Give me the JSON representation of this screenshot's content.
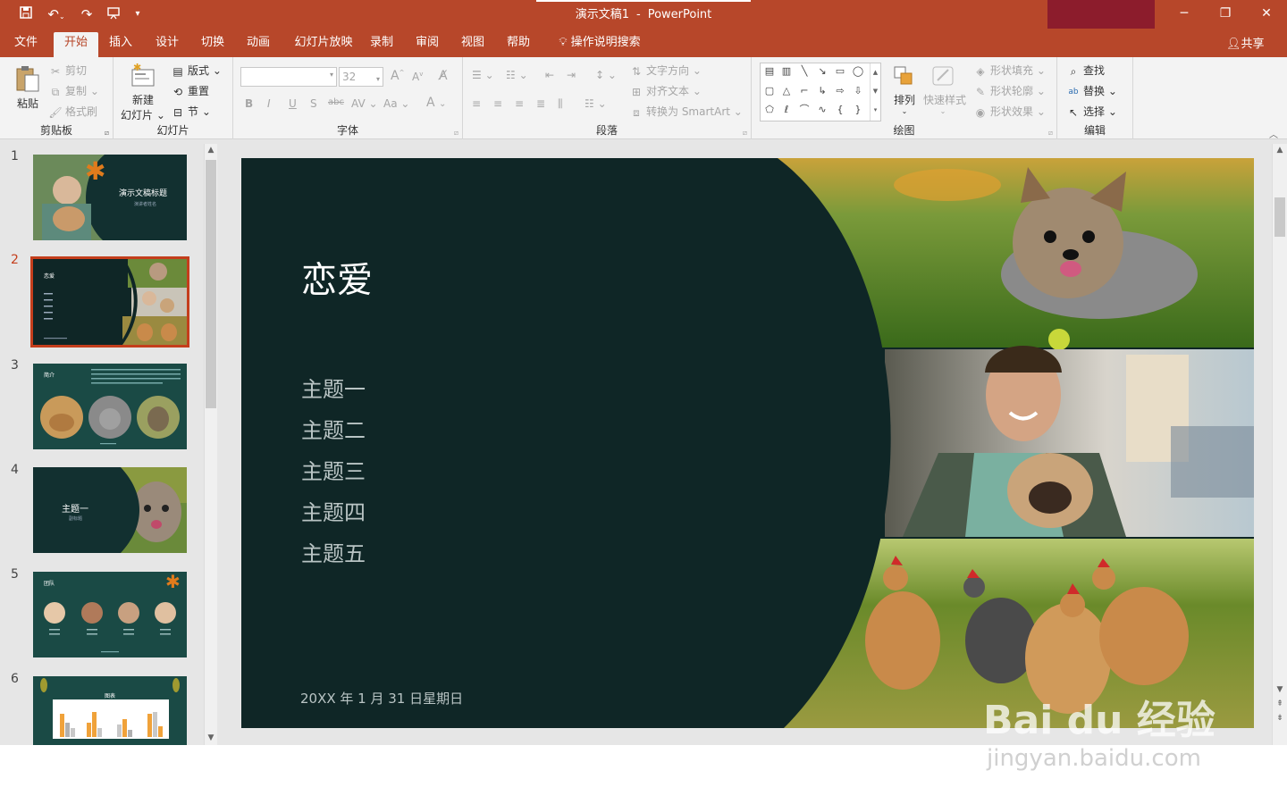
{
  "titlebar": {
    "doc_name": "演示文稿1",
    "separator": "-",
    "app_name": "PowerPoint",
    "quick_access": [
      "save-icon",
      "undo-icon",
      "redo-icon",
      "present-icon",
      "customize-icon"
    ]
  },
  "tabs": [
    "文件",
    "开始",
    "插入",
    "设计",
    "切换",
    "动画",
    "幻灯片放映",
    "录制",
    "审阅",
    "视图",
    "帮助"
  ],
  "tell_me": "操作说明搜索",
  "share": "共享",
  "ribbon": {
    "clipboard": {
      "label": "剪贴板",
      "paste": "粘贴",
      "cut": "剪切",
      "copy": "复制",
      "format_painter": "格式刷"
    },
    "slides": {
      "label": "幻灯片",
      "new_slide_1": "新建",
      "new_slide_2": "幻灯片",
      "layout": "版式",
      "reset": "重置",
      "section": "节"
    },
    "font": {
      "label": "字体",
      "font_name": "",
      "font_size": "32",
      "bold": "B",
      "italic": "I",
      "underline": "U",
      "shadow": "S",
      "strike": "abc",
      "spacing": "AV",
      "case": "Aa",
      "color": "A"
    },
    "paragraph": {
      "label": "段落",
      "text_direction": "文字方向",
      "align_text": "对齐文本",
      "smartart": "转换为 SmartArt"
    },
    "drawing": {
      "label": "绘图",
      "arrange": "排列",
      "quick_styles": "快速样式",
      "shape_fill": "形状填充",
      "shape_outline": "形状轮廓",
      "shape_effects": "形状效果"
    },
    "editing": {
      "label": "编辑",
      "find": "查找",
      "replace": "替换",
      "select": "选择"
    }
  },
  "thumbnails": [
    {
      "num": "1",
      "title": "演示文稿标题",
      "subtitle": "演讲者姓名"
    },
    {
      "num": "2",
      "title": "恋爱"
    },
    {
      "num": "3",
      "title": "简介"
    },
    {
      "num": "4",
      "title": "主题一",
      "subtitle": "副标题"
    },
    {
      "num": "5",
      "title": "团队"
    },
    {
      "num": "6",
      "title": "图表"
    }
  ],
  "slide": {
    "title": "恋爱",
    "topics": [
      "主题一",
      "主题二",
      "主题三",
      "主题四",
      "主题五"
    ],
    "date": "20XX 年 1 月 31 日星期日",
    "photos": [
      "yorkie-dog-photo",
      "man-with-pug-photo",
      "chickens-photo"
    ]
  },
  "watermark": {
    "logo": "Bai du 经验",
    "url": "jingyan.baidu.com"
  },
  "colors": {
    "accent": "#b7472a",
    "slide_bg": "#0f2626",
    "selection": "#c43e1c"
  }
}
